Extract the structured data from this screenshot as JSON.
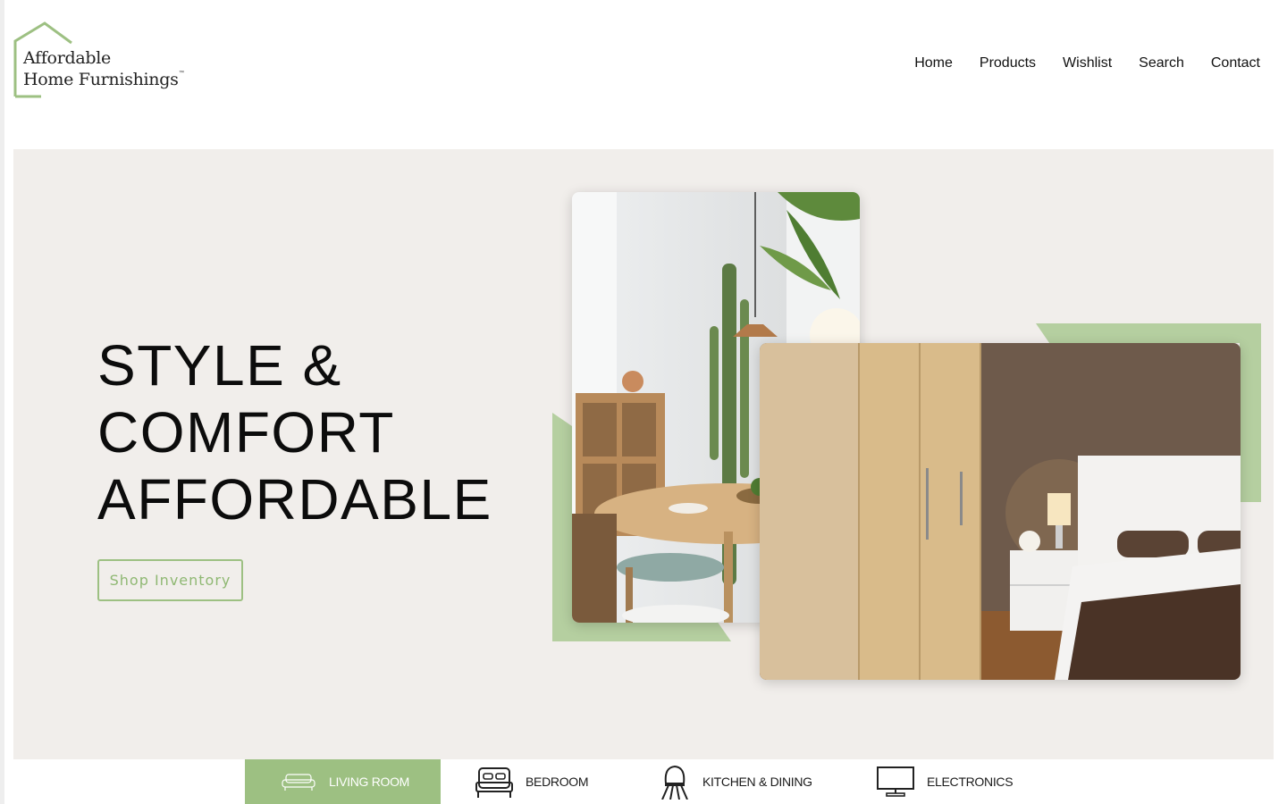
{
  "brand": {
    "line1": "Affordable",
    "line2": "Home Furnishings",
    "tm": "™",
    "accent_color": "#9dc082"
  },
  "nav": {
    "items": [
      "Home",
      "Products",
      "Wishlist",
      "Search",
      "Contact"
    ]
  },
  "hero": {
    "headline": [
      "STYLE &",
      "COMFORT",
      "AFFORDABLE"
    ],
    "cta_label": "Shop Inventory",
    "background_color": "#f1eeeb",
    "images": [
      "dining-room-photo",
      "bedroom-photo"
    ]
  },
  "categories": {
    "items": [
      {
        "label": "LIVING ROOM",
        "icon": "sofa-icon",
        "active": true
      },
      {
        "label": "BEDROOM",
        "icon": "bed-icon",
        "active": false
      },
      {
        "label": "KITCHEN & DINING",
        "icon": "chair-icon",
        "active": false
      },
      {
        "label": "ELECTRONICS",
        "icon": "tv-icon",
        "active": false
      }
    ]
  }
}
